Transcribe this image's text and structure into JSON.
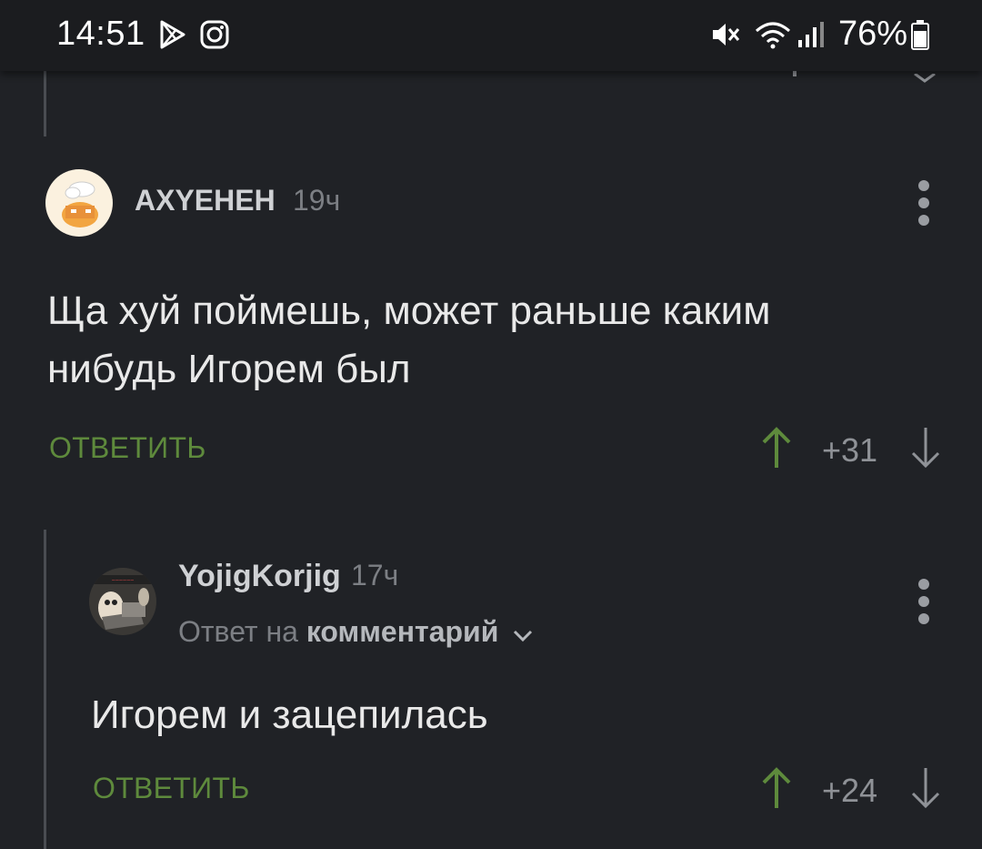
{
  "status_bar": {
    "time": "14:51",
    "battery": "76%",
    "icons": [
      "play-store-icon",
      "instagram-icon",
      "mute-icon",
      "wifi-icon",
      "signal-icon",
      "battery-icon"
    ]
  },
  "comments": [
    {
      "username": "AXYEHEH",
      "time": "19ч",
      "text_line1": "Ща хуй поймешь, может раньше каким",
      "text_line2": "нибудь Игорем был",
      "reply_label": "ОТВЕТИТЬ",
      "score": "+31"
    },
    {
      "username": "YojigKorjig",
      "time": "17ч",
      "reply_prefix": "Ответ на",
      "reply_target": "комментарий",
      "text": "Игорем и зацепилась",
      "reply_label": "ОТВЕТИТЬ",
      "score": "+24"
    }
  ],
  "colors": {
    "background": "#202226",
    "reply_green": "#5e8a3c",
    "upvote_green": "#5e8a3c",
    "muted": "#7c7f84"
  }
}
